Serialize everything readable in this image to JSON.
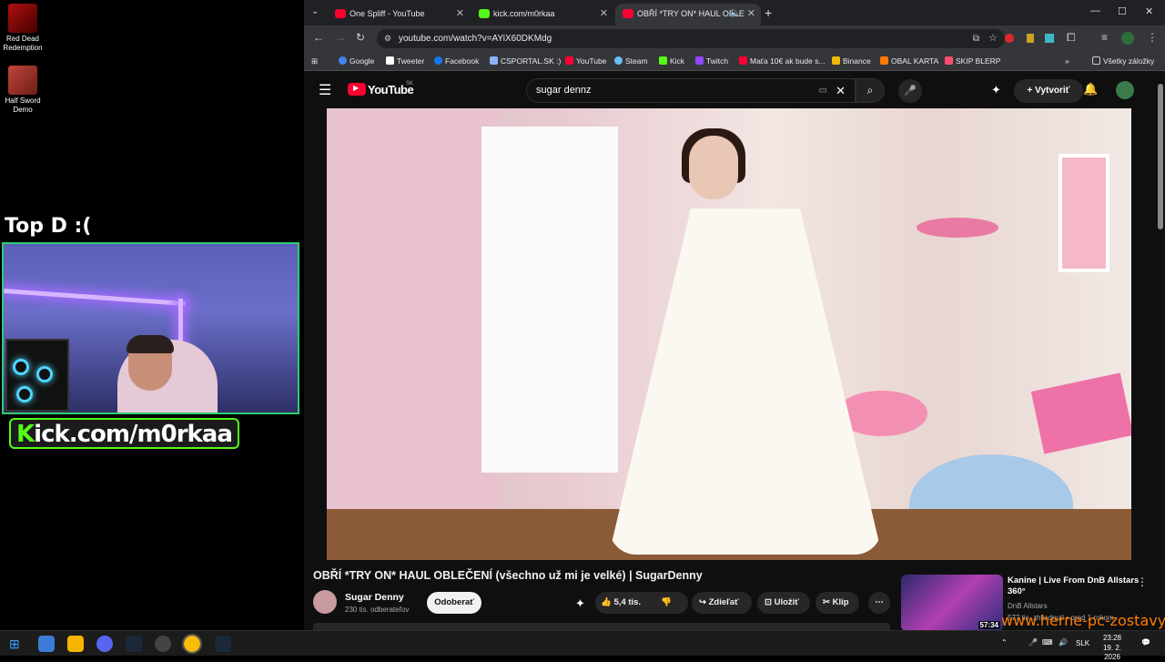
{
  "desktop": {
    "icons": [
      {
        "label": "Red Dead Redemption"
      },
      {
        "label": "Half Sword Demo"
      }
    ],
    "overlay_title": "Top D :(",
    "kick_text_prefix": "K",
    "kick_text_rest": "ick.com/m0rkaa"
  },
  "browser": {
    "tabs": [
      {
        "title": "One Spliff - YouTube",
        "color": "#ff0033"
      },
      {
        "title": "kick.com/m0rkaa",
        "color": "#53fc18"
      },
      {
        "title": "OBŘÍ *TRY ON* HAUL OBLE",
        "color": "#ff0033"
      }
    ],
    "url": "youtube.com/watch?v=AYiX60DKMdg",
    "bookmarks": [
      {
        "label": "Google",
        "color": "#4285f4"
      },
      {
        "label": "Tweeter",
        "color": "#ffffff"
      },
      {
        "label": "Facebook",
        "color": "#1877f2"
      },
      {
        "label": "CSPORTAL.SK :)",
        "color": "#8ab4f8"
      },
      {
        "label": "YouTube",
        "color": "#ff0033"
      },
      {
        "label": "Steam",
        "color": "#66c0f4"
      },
      {
        "label": "Kick",
        "color": "#53fc18"
      },
      {
        "label": "Twitch",
        "color": "#9146ff"
      },
      {
        "label": "Maťa 10€ ak bude s...",
        "color": "#ff0033"
      },
      {
        "label": "Binance",
        "color": "#f0b90b"
      },
      {
        "label": "OBAL KARTA",
        "color": "#ff7a00"
      },
      {
        "label": "SKIP BLERP",
        "color": "#ff4d6d"
      }
    ],
    "all_bookmarks": "Všetky záložky"
  },
  "youtube": {
    "logo": "YouTube",
    "region": "SK",
    "search_value": "sugar dennz",
    "create_label": "Vytvoriť",
    "video_title": "OBŘÍ *TRY ON* HAUL OBLEČENÍ (všechno už mi je velké) | SugarDenny",
    "channel_name": "Sugar Denny",
    "subscribers": "230 tis. odberateľov",
    "subscribe_label": "Odoberať",
    "likes": "5,4 tis.",
    "share_label": "Zdieľať",
    "save_label": "Uložiť",
    "clip_label": "Klip",
    "recommended": {
      "title": "Kanine | Live From DnB Allstars 360°",
      "channel": "DnB Allstars",
      "duration": "57:34",
      "meta": "577 tis. zhliadnutí • pred 1 rokom"
    }
  },
  "taskbar": {
    "lang": "SLK",
    "time": "23:28",
    "date": "19. 2. 2026"
  },
  "watermark": "www.herne-pc-zostavy.sk"
}
